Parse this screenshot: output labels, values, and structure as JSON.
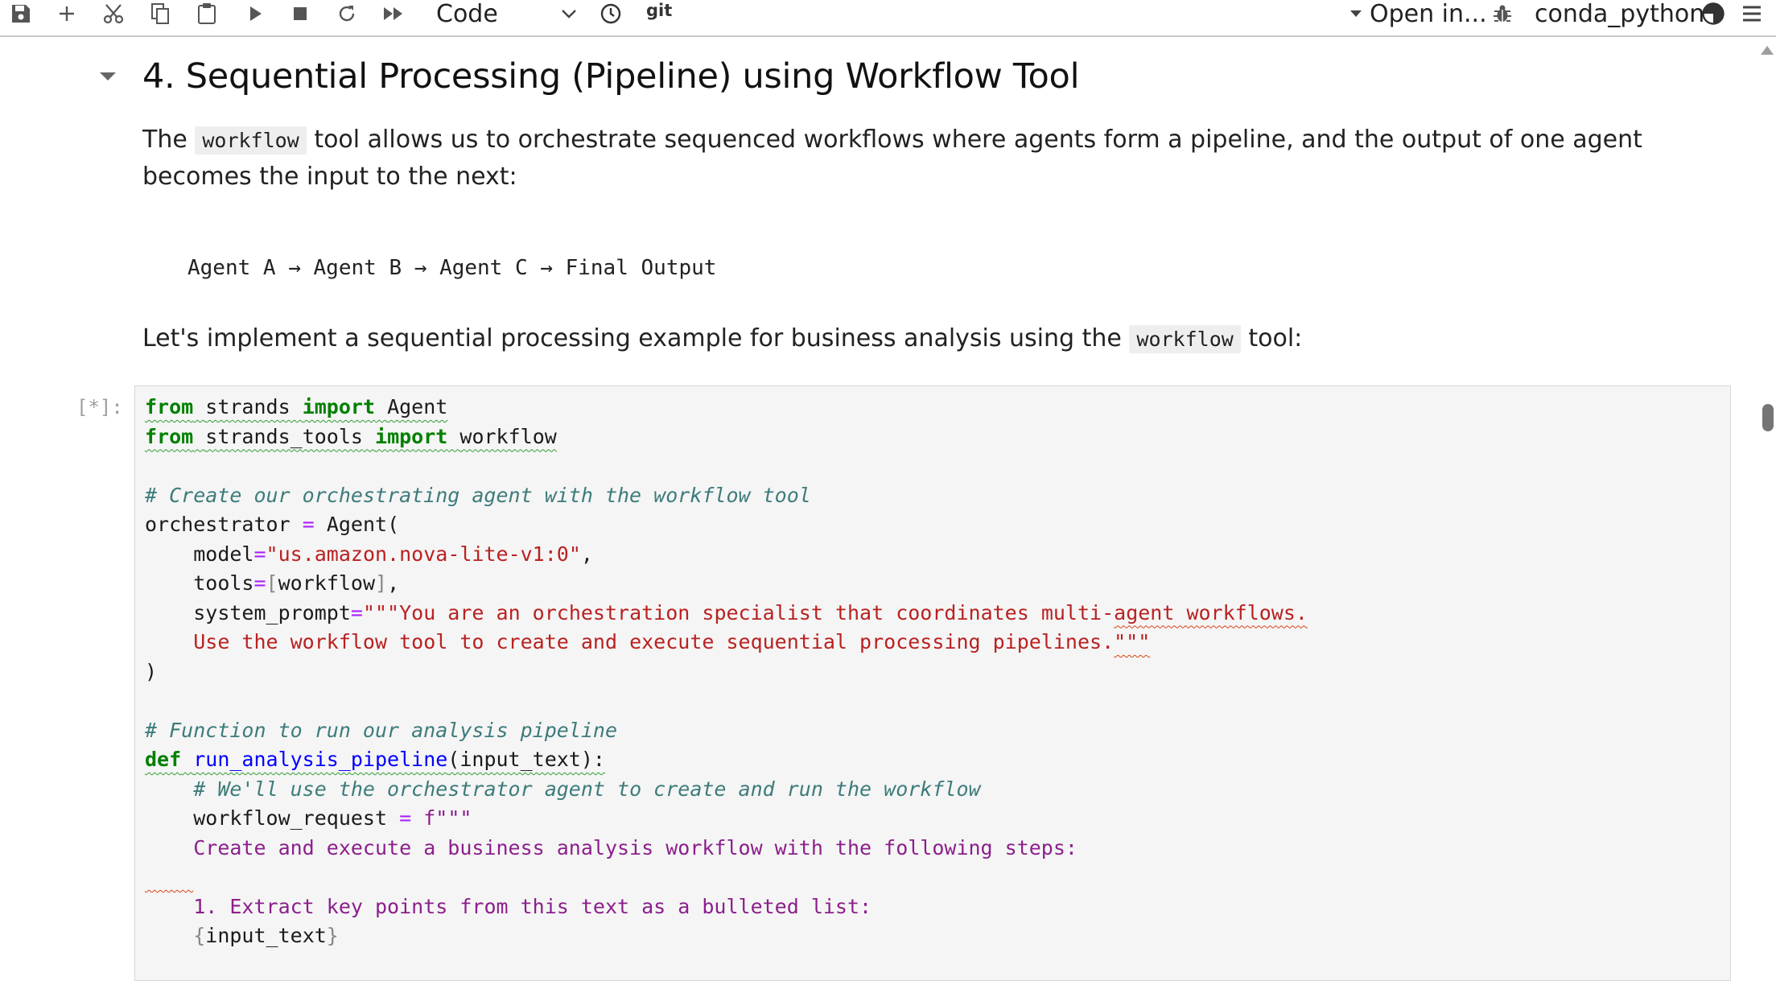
{
  "toolbar": {
    "cell_type": "Code",
    "git_label": "git",
    "open_in_label": "Open in...",
    "kernel_name": "conda_python3"
  },
  "notebook": {
    "heading": "4. Sequential Processing (Pipeline) using Workflow Tool",
    "intro": {
      "before": "The",
      "code": "workflow",
      "after": "tool allows us to orchestrate sequenced workflows where agents form a pipeline, and the output of one agent becomes the input to the next:"
    },
    "flow_diagram": "Agent A → Agent B → Agent C → Final Output",
    "implement": {
      "before": "Let's implement a sequential processing example for business analysis using the",
      "code": "workflow",
      "after": "tool:"
    },
    "cell_prompt": "[*]:",
    "code": {
      "from": "from",
      "import": "import",
      "def": "def",
      "mod1": "strands",
      "cls1": "Agent",
      "mod2": "strands_tools",
      "cls2": "workflow",
      "comment1": "# Create our orchestrating agent with the workflow tool",
      "orchestrator": "orchestrator",
      "agent_call": "Agent(",
      "model_arg": "model",
      "model_value": "\"us.amazon.nova-lite-v1:0\"",
      "tools_arg": "tools",
      "tools_value": "workflow",
      "system_prompt_arg": "system_prompt",
      "sp_line1_a": "\"\"\"You are an orchestration specialist that coordinates multi-",
      "sp_line1_b": "agent workflows.",
      "sp_line2_a": "Use the workflow tool to create and execute sequential processing pipelines.",
      "sp_line2_b": "\"\"\"",
      "close_paren": ")",
      "comment2": "# Function to run our analysis pipeline",
      "func_name": "run_analysis_pipeline",
      "func_params": "(input_text):",
      "comment3": "# We'll use the orchestrator agent to create and run the workflow",
      "wf_request": "workflow_request",
      "fstring_open": "f\"\"\"",
      "fstring_line1": "Create and execute a business analysis workflow with the following steps:",
      "fstring_line2": "1. Extract key points from this text as a bulleted list:",
      "input_text": "input_text"
    }
  }
}
